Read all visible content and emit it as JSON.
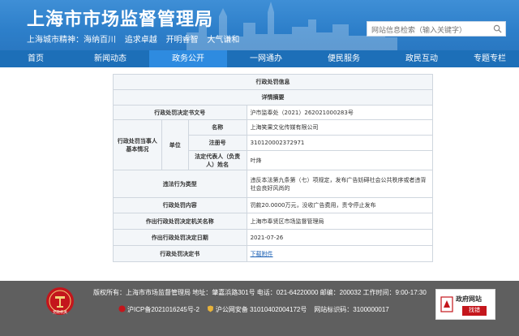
{
  "header": {
    "site_title": "上海市市场监督管理局",
    "slogan_label": "上海城市精神：海纳百川",
    "slogan_items": [
      "追求卓越",
      "开明睿智",
      "大气谦和"
    ],
    "search_placeholder": "网站信息检索（输入关键字）"
  },
  "nav": {
    "items": [
      "首页",
      "新闻动态",
      "政务公开",
      "一网通办",
      "便民服务",
      "政民互动",
      "专题专栏"
    ],
    "active_index": 2
  },
  "record": {
    "title": "行政处罚信息",
    "subtitle": "详情摘要",
    "doc_no_label": "行政处罚决定书文号",
    "doc_no": "沪市监奉处（2021）262021000283号",
    "party_label": "行政处罚当事人基本情况",
    "unit_label": "单位",
    "name_label": "名称",
    "name": "上海笑果文化传媒有限公司",
    "reg_no_label": "注册号",
    "reg_no": "310120002372971",
    "legal_rep_label": "法定代表人（负责人）姓名",
    "legal_rep": "叶烽",
    "violation_type_label": "违法行为类型",
    "violation_type": "违反本法第九条第（七）项规定，发布广告妨碍社会公共秩序或者违背社会良好风尚的",
    "penalty_content_label": "行政处罚内容",
    "penalty_content": "罚款20.0000万元，没收广告费用，责令停止发布",
    "authority_label": "作出行政处罚决定机关名称",
    "authority": "上海市奉贤区市场监督管理局",
    "date_label": "作出行政处罚决定日期",
    "date": "2021-07-26",
    "doc_label": "行政处罚决定书",
    "doc_link": "下载附件"
  },
  "footer": {
    "line1": "版权所有：上海市市场监督管理局 地址：肇嘉浜路301号 电话：021-64220000 邮编：200032 工作时间：9:00-17:30",
    "icp": "沪ICP备2021016245号-2",
    "police_record": "沪公网安备 31010402004172号",
    "site_id": "网站标识码：3100000017",
    "badge_title": "政府网站",
    "badge_button": "找错",
    "emblem_text": "党政机关"
  },
  "colors": {
    "header_blue": "#2d7fca",
    "nav_blue": "#1d6fb8",
    "nav_active": "#2e8be0",
    "footer_gray": "#5f5f5f",
    "emblem_red": "#c4161c"
  }
}
